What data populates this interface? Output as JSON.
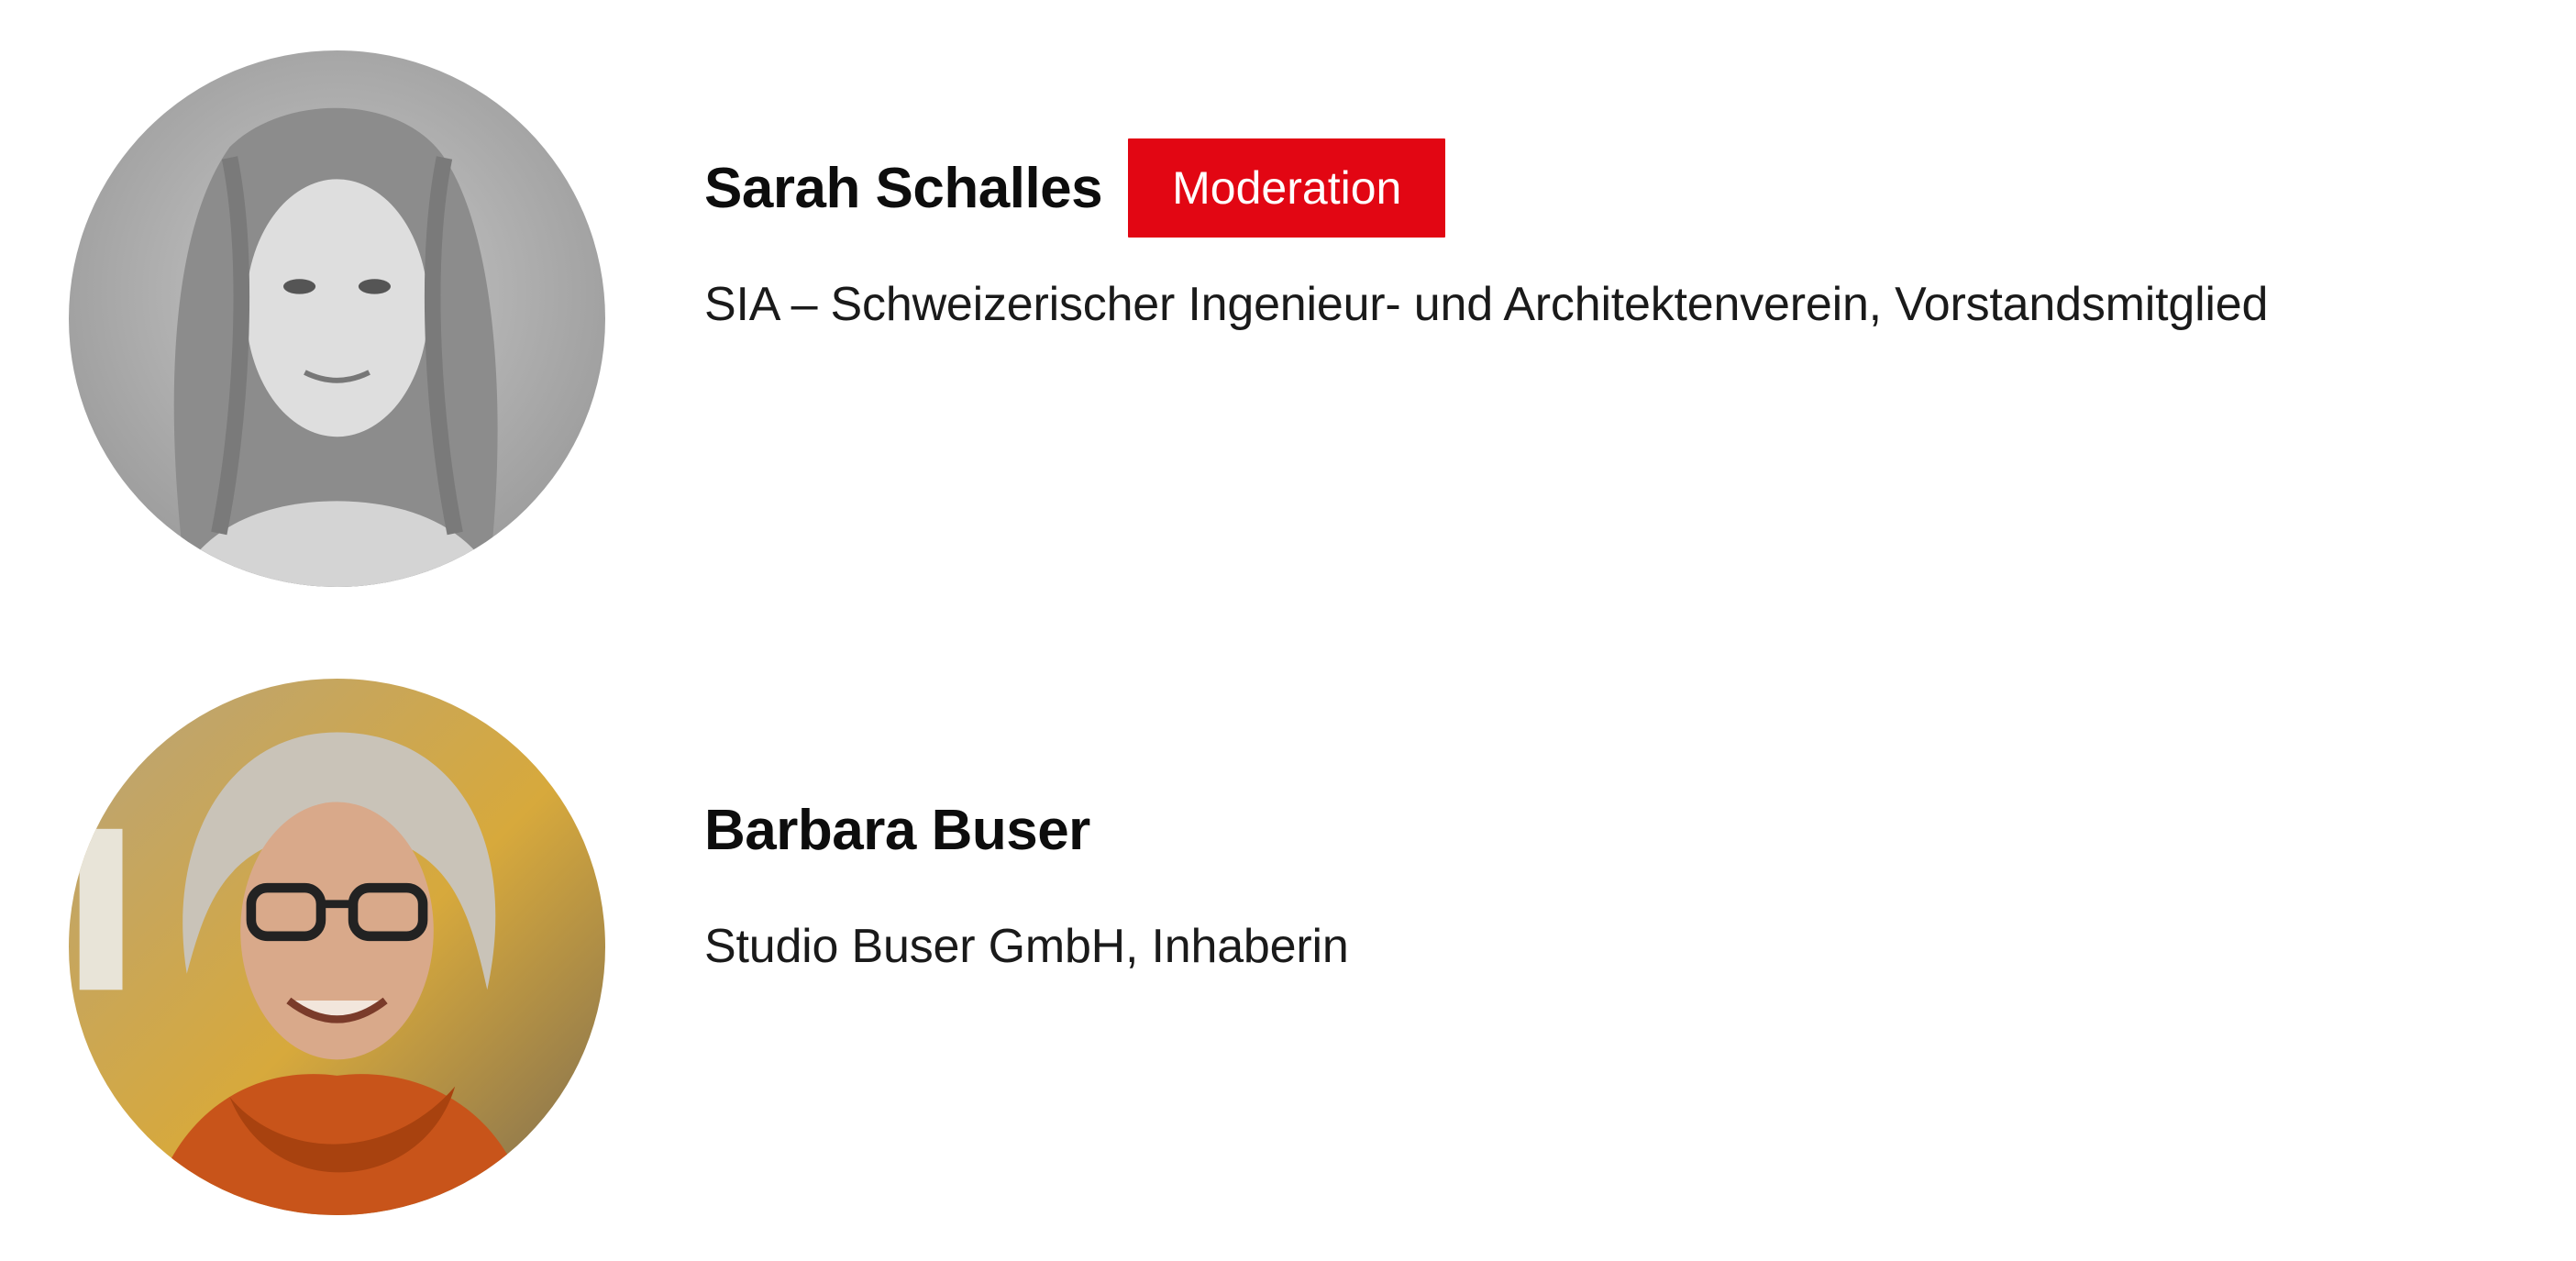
{
  "accent_color": "#e20613",
  "speakers": [
    {
      "name": "Sarah Schalles",
      "badge": "Moderation",
      "role": "SIA – Schweizerischer Ingenieur- und Architektenverein, Vorstandsmitglied",
      "photo": "portrait-photo-grayscale"
    },
    {
      "name": "Barbara Buser",
      "role": "Studio Buser GmbH, Inhaberin",
      "photo": "portrait-photo-color"
    }
  ]
}
